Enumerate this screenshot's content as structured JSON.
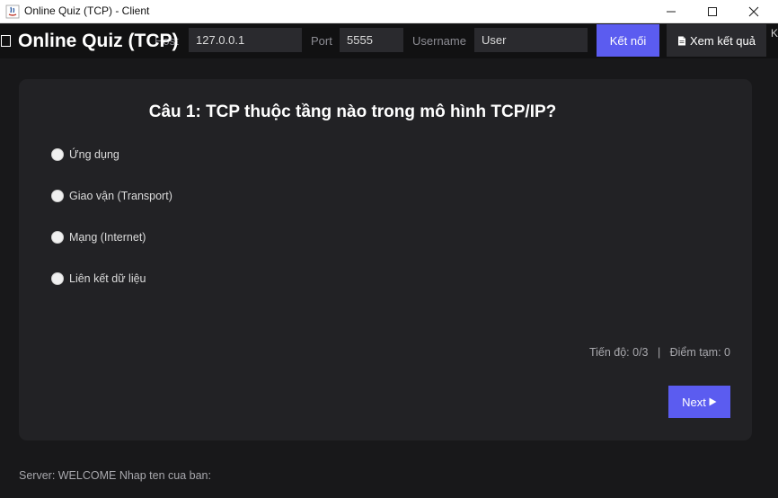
{
  "window": {
    "title": "Online Quiz (TCP) - Client",
    "icons": [
      "java-app-icon",
      "minimize-icon",
      "maximize-icon",
      "close-icon"
    ]
  },
  "toolbar": {
    "heading": "Online Quiz (TCP)",
    "host_label": "Host",
    "host_value": "127.0.0.1",
    "port_label": "Port",
    "port_value": "5555",
    "username_label": "Username",
    "username_value": "User",
    "connect_label": "Kết nối",
    "results_label": "Xem kết quả",
    "results_icon": "document-icon",
    "edge_glyph": "K"
  },
  "quiz": {
    "question": "Câu 1: TCP thuộc tầng nào trong mô hình TCP/IP?",
    "options": [
      "Ứng dụng",
      "Giao vận (Transport)",
      "Mạng (Internet)",
      "Liên kết dữ liệu"
    ],
    "progress_label": "Tiến độ: 0/3",
    "separator": "|",
    "score_label": "Điểm tạm: 0",
    "next_label": "Next",
    "next_icon": "play-triangle-icon"
  },
  "status": {
    "text": "Server: WELCOME Nhap ten cua ban:"
  },
  "colors": {
    "accent": "#5b5cf0",
    "background": "#18181a",
    "card": "#222225",
    "toolbar": "#111112",
    "field": "#2a2a2e"
  }
}
